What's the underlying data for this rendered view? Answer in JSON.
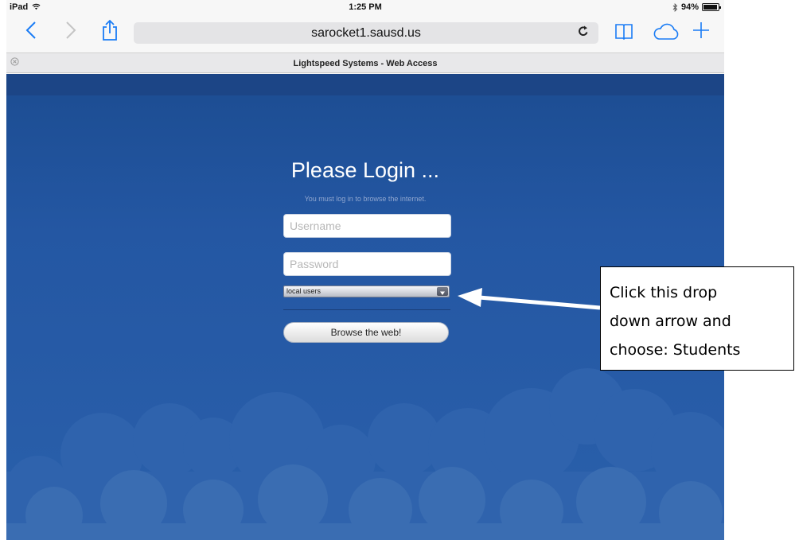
{
  "status_bar": {
    "device": "iPad",
    "time": "1:25 PM",
    "battery": "94%",
    "battery_level": 0.94,
    "wifi_icon": "wifi-icon",
    "bluetooth_icon": "bluetooth-icon"
  },
  "toolbar": {
    "back_icon": "back-chevron-icon",
    "forward_icon": "forward-chevron-icon",
    "share_icon": "share-icon",
    "url": "sarocket1.sausd.us",
    "reload_icon": "reload-icon",
    "bookmarks_icon": "bookmarks-icon",
    "icloud_tabs_icon": "cloud-icon",
    "new_tab_icon": "plus-icon"
  },
  "tab": {
    "title": "Lightspeed Systems - Web Access",
    "close_icon": "close-icon"
  },
  "login": {
    "title": "Please Login ...",
    "subtitle": "You must log in to browse the internet.",
    "username_placeholder": "Username",
    "password_placeholder": "Password",
    "domain_selected": "local users",
    "submit_label": "Browse the web!"
  },
  "callout": {
    "lines": [
      "Click this drop",
      "down arrow and",
      "choose: Students"
    ]
  },
  "colors": {
    "page_background": "#2457a3",
    "ios_accent": "#1a7cf5",
    "header_band": "#1c4586",
    "clouds": "#3a6db2"
  }
}
